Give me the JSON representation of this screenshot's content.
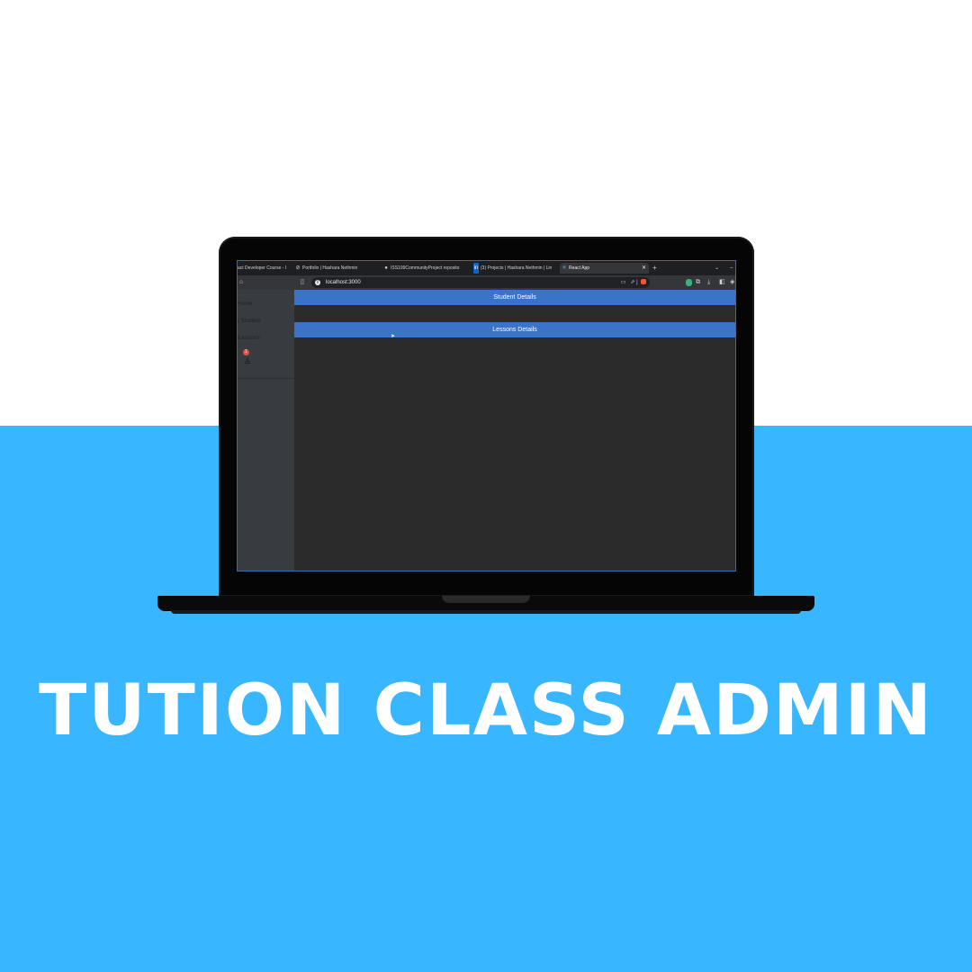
{
  "colors": {
    "background_top": "#ffffff",
    "background_bottom": "#38b6ff",
    "section_bar": "#3b73c8",
    "sidebar": "#383b40",
    "main_area": "#2b2b2b"
  },
  "browser": {
    "tabs": [
      {
        "label": "act Developer Course - I",
        "icon": "youtube-icon",
        "active": false
      },
      {
        "label": "Portfolio | Hashara Nethmin",
        "icon": "globe-icon",
        "active": false
      },
      {
        "label": "ISS199CommunityProject reposito",
        "icon": "github-icon",
        "active": false
      },
      {
        "label": "(3) Projects | Hashara Nethmin | Lin",
        "icon": "linkedin-icon",
        "active": false
      },
      {
        "label": "React App",
        "icon": "react-icon",
        "active": true
      }
    ],
    "new_tab": "+",
    "address": "localhost:3000"
  },
  "sidebar": {
    "items": [
      {
        "label": "Home"
      },
      {
        "label": "Student"
      },
      {
        "label": "Lessons"
      }
    ],
    "badge": "1"
  },
  "main": {
    "sections": [
      {
        "label": "Student Details"
      },
      {
        "label": "Lessons Details"
      }
    ]
  },
  "headline": "TUTION CLASS ADMIN"
}
